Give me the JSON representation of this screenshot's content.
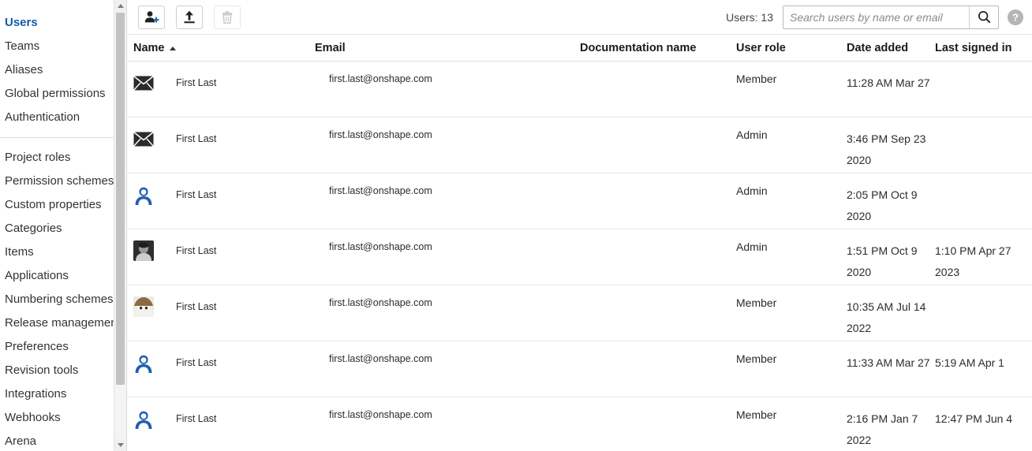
{
  "sidebar": {
    "groups": [
      {
        "items": [
          {
            "label": "Users",
            "active": true
          },
          {
            "label": "Teams",
            "active": false
          },
          {
            "label": "Aliases",
            "active": false
          },
          {
            "label": "Global permissions",
            "active": false
          },
          {
            "label": "Authentication",
            "active": false
          }
        ]
      },
      {
        "items": [
          {
            "label": "Project roles",
            "active": false
          },
          {
            "label": "Permission schemes",
            "active": false
          },
          {
            "label": "Custom properties",
            "active": false
          },
          {
            "label": "Categories",
            "active": false
          },
          {
            "label": "Items",
            "active": false
          },
          {
            "label": "Applications",
            "active": false
          },
          {
            "label": "Numbering schemes",
            "active": false
          },
          {
            "label": "Release management",
            "active": false
          },
          {
            "label": "Preferences",
            "active": false
          },
          {
            "label": "Revision tools",
            "active": false
          },
          {
            "label": "Integrations",
            "active": false
          },
          {
            "label": "Webhooks",
            "active": false
          },
          {
            "label": "Arena",
            "active": false
          }
        ]
      }
    ],
    "scrollbar": {
      "up_icon": "caret-up-icon",
      "down_icon": "caret-down-icon"
    }
  },
  "toolbar": {
    "add_user_icon": "add-user-icon",
    "upload_icon": "upload-icon",
    "delete_icon": "trash-icon",
    "delete_disabled": true,
    "users_count_label": "Users: 13",
    "search_placeholder": "Search users by name or email",
    "search_value": "",
    "search_icon": "search-icon",
    "help_icon": "help-circle-icon"
  },
  "table": {
    "columns": [
      {
        "key": "name",
        "label": "Name",
        "sorted": "asc"
      },
      {
        "key": "email",
        "label": "Email",
        "sorted": null
      },
      {
        "key": "doc",
        "label": "Documentation name",
        "sorted": null
      },
      {
        "key": "role",
        "label": "User role",
        "sorted": null
      },
      {
        "key": "added",
        "label": "Date added",
        "sorted": null
      },
      {
        "key": "signed",
        "label": "Last signed in",
        "sorted": null
      }
    ],
    "rows": [
      {
        "avatar": "envelope-icon",
        "name": "First Last",
        "email": "first.last@onshape.com",
        "doc": "",
        "role": "Member",
        "added": "11:28 AM Mar 27",
        "signed": ""
      },
      {
        "avatar": "envelope-icon",
        "name": "First Last",
        "email": "first.last@onshape.com",
        "doc": "",
        "role": "Admin",
        "added": "3:46 PM Sep 23 2020",
        "signed": ""
      },
      {
        "avatar": "person-silhouette-icon",
        "name": "First Last",
        "email": "first.last@onshape.com",
        "doc": "",
        "role": "Admin",
        "added": "2:05 PM Oct 9 2020",
        "signed": ""
      },
      {
        "avatar": "photo-avatar-dark",
        "name": "First Last",
        "email": "first.last@onshape.com",
        "doc": "",
        "role": "Admin",
        "added": "1:51 PM Oct 9 2020",
        "signed": "1:10 PM Apr 27 2023"
      },
      {
        "avatar": "photo-avatar-light",
        "name": "First Last",
        "email": "first.last@onshape.com",
        "doc": "",
        "role": "Member",
        "added": "10:35 AM Jul 14 2022",
        "signed": ""
      },
      {
        "avatar": "person-silhouette-icon",
        "name": "First Last",
        "email": "first.last@onshape.com",
        "doc": "",
        "role": "Member",
        "added": "11:33 AM Mar 27",
        "signed": "5:19 AM Apr 1"
      },
      {
        "avatar": "person-silhouette-icon",
        "name": "First Last",
        "email": "first.last@onshape.com",
        "doc": "",
        "role": "Member",
        "added": "2:16 PM Jan 7 2022",
        "signed": "12:47 PM Jun 4"
      }
    ]
  },
  "colors": {
    "accent": "#1659a8",
    "avatar_blue": "#1f5fb0",
    "border": "#e6e6e6",
    "text": "#2b2b2b"
  }
}
